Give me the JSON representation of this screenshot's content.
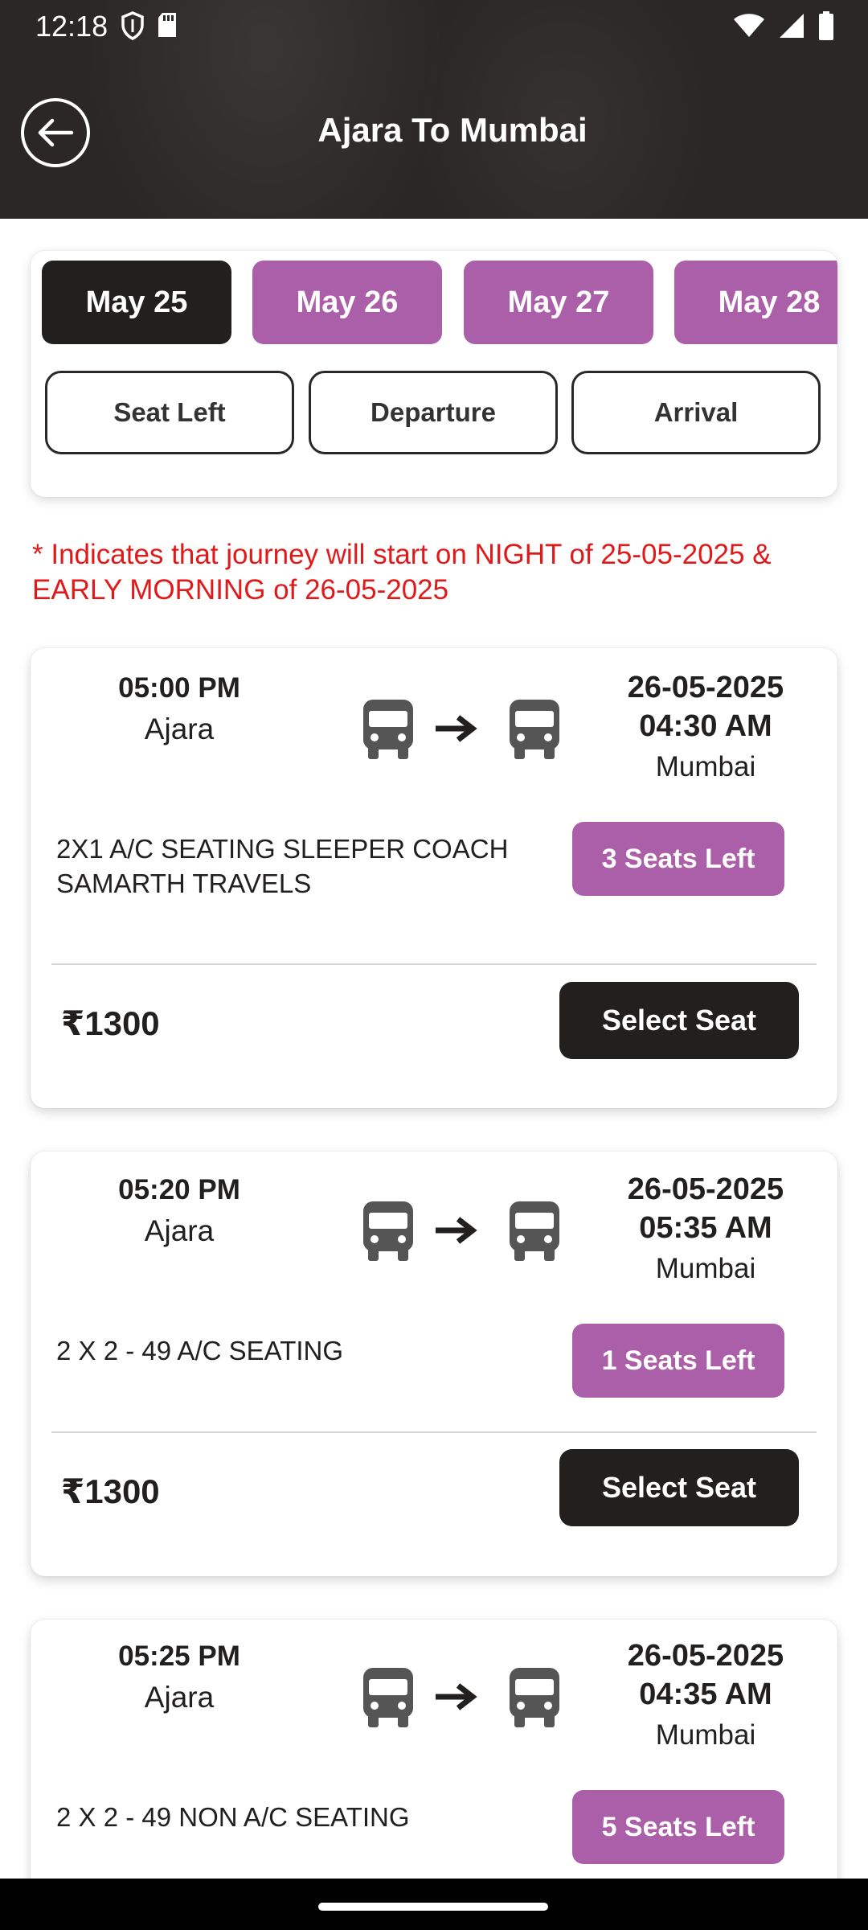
{
  "status_bar": {
    "time": "12:18",
    "left_icons": [
      "shield-icon",
      "sd-card-icon"
    ],
    "right_icons": [
      "wifi-icon",
      "cell-signal-icon",
      "battery-icon"
    ]
  },
  "header": {
    "title": "Ajara To Mumbai",
    "back_icon": "arrow-left-circle-icon"
  },
  "date_tabs": [
    {
      "label": "May 25",
      "selected": true
    },
    {
      "label": "May 26",
      "selected": false
    },
    {
      "label": "May 27",
      "selected": false
    },
    {
      "label": "May 28",
      "selected": false
    }
  ],
  "sort_buttons": [
    {
      "label": "Seat Left"
    },
    {
      "label": "Departure"
    },
    {
      "label": "Arrival"
    }
  ],
  "notice": "* Indicates that journey will start on NIGHT of 25-05-2025 & EARLY MORNING of 26-05-2025",
  "trips": [
    {
      "departure_time": "05:00 PM",
      "departure_city": "Ajara",
      "arrival_date": "26-05-2025",
      "arrival_time": "04:30 AM",
      "arrival_city": "Mumbai",
      "bus_type": "2X1 A/C SEATING SLEEPER COACH",
      "operator": "SAMARTH TRAVELS",
      "seats_left": "3 Seats Left",
      "price": "₹1300",
      "select_label": "Select Seat"
    },
    {
      "departure_time": "05:20 PM",
      "departure_city": "Ajara",
      "arrival_date": "26-05-2025",
      "arrival_time": "05:35 AM",
      "arrival_city": "Mumbai",
      "bus_type": "2 X 2 - 49 A/C SEATING",
      "operator": "",
      "seats_left": "1 Seats Left",
      "price": "₹1300",
      "select_label": "Select Seat"
    },
    {
      "departure_time": "05:25 PM",
      "departure_city": "Ajara",
      "arrival_date": "26-05-2025",
      "arrival_time": "04:35 AM",
      "arrival_city": "Mumbai",
      "bus_type": "2 X 2 - 49 NON A/C SEATING",
      "operator": "",
      "seats_left": "5 Seats Left"
    }
  ],
  "colors": {
    "header_bg": "#2b2727",
    "selected_tab": "#221f1f",
    "accent_purple": "#ab5fa8",
    "notice_red": "#e0191b",
    "button_dark": "#221f1f"
  },
  "route_icons": [
    "bus-icon",
    "arrow-right-icon",
    "bus-icon"
  ]
}
